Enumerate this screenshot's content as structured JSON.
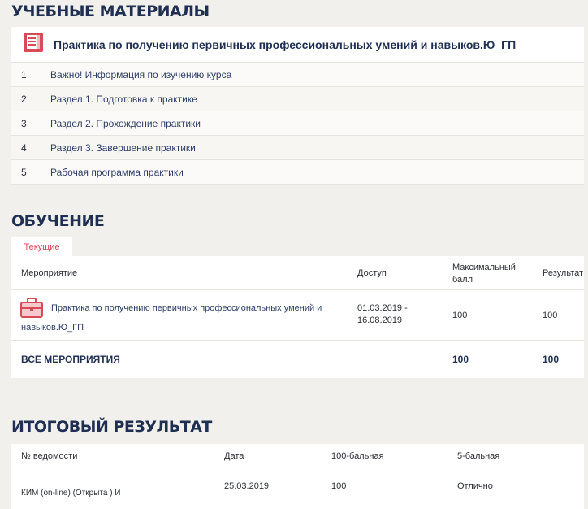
{
  "materials": {
    "title": "УЧЕБНЫЕ МАТЕРИАЛЫ",
    "course_title": "Практика по получению первичных профессиональных умений и навыков.Ю_ГП",
    "items": [
      {
        "num": "1",
        "label": "Важно! Информация по изучению курса"
      },
      {
        "num": "2",
        "label": "Раздел 1. Подготовка к практике"
      },
      {
        "num": "3",
        "label": "Раздел 2. Прохождение практики"
      },
      {
        "num": "4",
        "label": "Раздел 3. Завершение практики"
      },
      {
        "num": "5",
        "label": "Рабочая программа практики"
      }
    ]
  },
  "education": {
    "title": "ОБУЧЕНИЕ",
    "tab": "Текущие",
    "headers": {
      "event": "Мероприятие",
      "access": "Доступ",
      "max_score_1": "Максимальный",
      "max_score_2": "балл",
      "result": "Результат"
    },
    "row": {
      "event_1": "Практика по получению первичных профессиональных умений и",
      "event_2": "навыков.Ю_ГП",
      "access_1": "01.03.2019 -",
      "access_2": "16.08.2019",
      "max_score": "100",
      "result": "100"
    },
    "total": {
      "label": "ВСЕ МЕРОПРИЯТИЯ",
      "max_score": "100",
      "result": "100"
    }
  },
  "final": {
    "title": "ИТОГОВЫЙ РЕЗУЛЬТАТ",
    "headers": {
      "statement": "№ ведомости",
      "date": "Дата",
      "score100": "100-бальная",
      "score5": "5-бальная"
    },
    "row": {
      "statement": "КИМ (on-line) (Открыта ) И",
      "date": "25.03.2019",
      "score100": "100",
      "score5": "Отлично"
    }
  },
  "colors": {
    "title": "#1f2f52",
    "accent": "#d94a57",
    "background": "#f1f0ed"
  },
  "icons": {
    "course": "book-icon",
    "event": "briefcase-icon"
  }
}
